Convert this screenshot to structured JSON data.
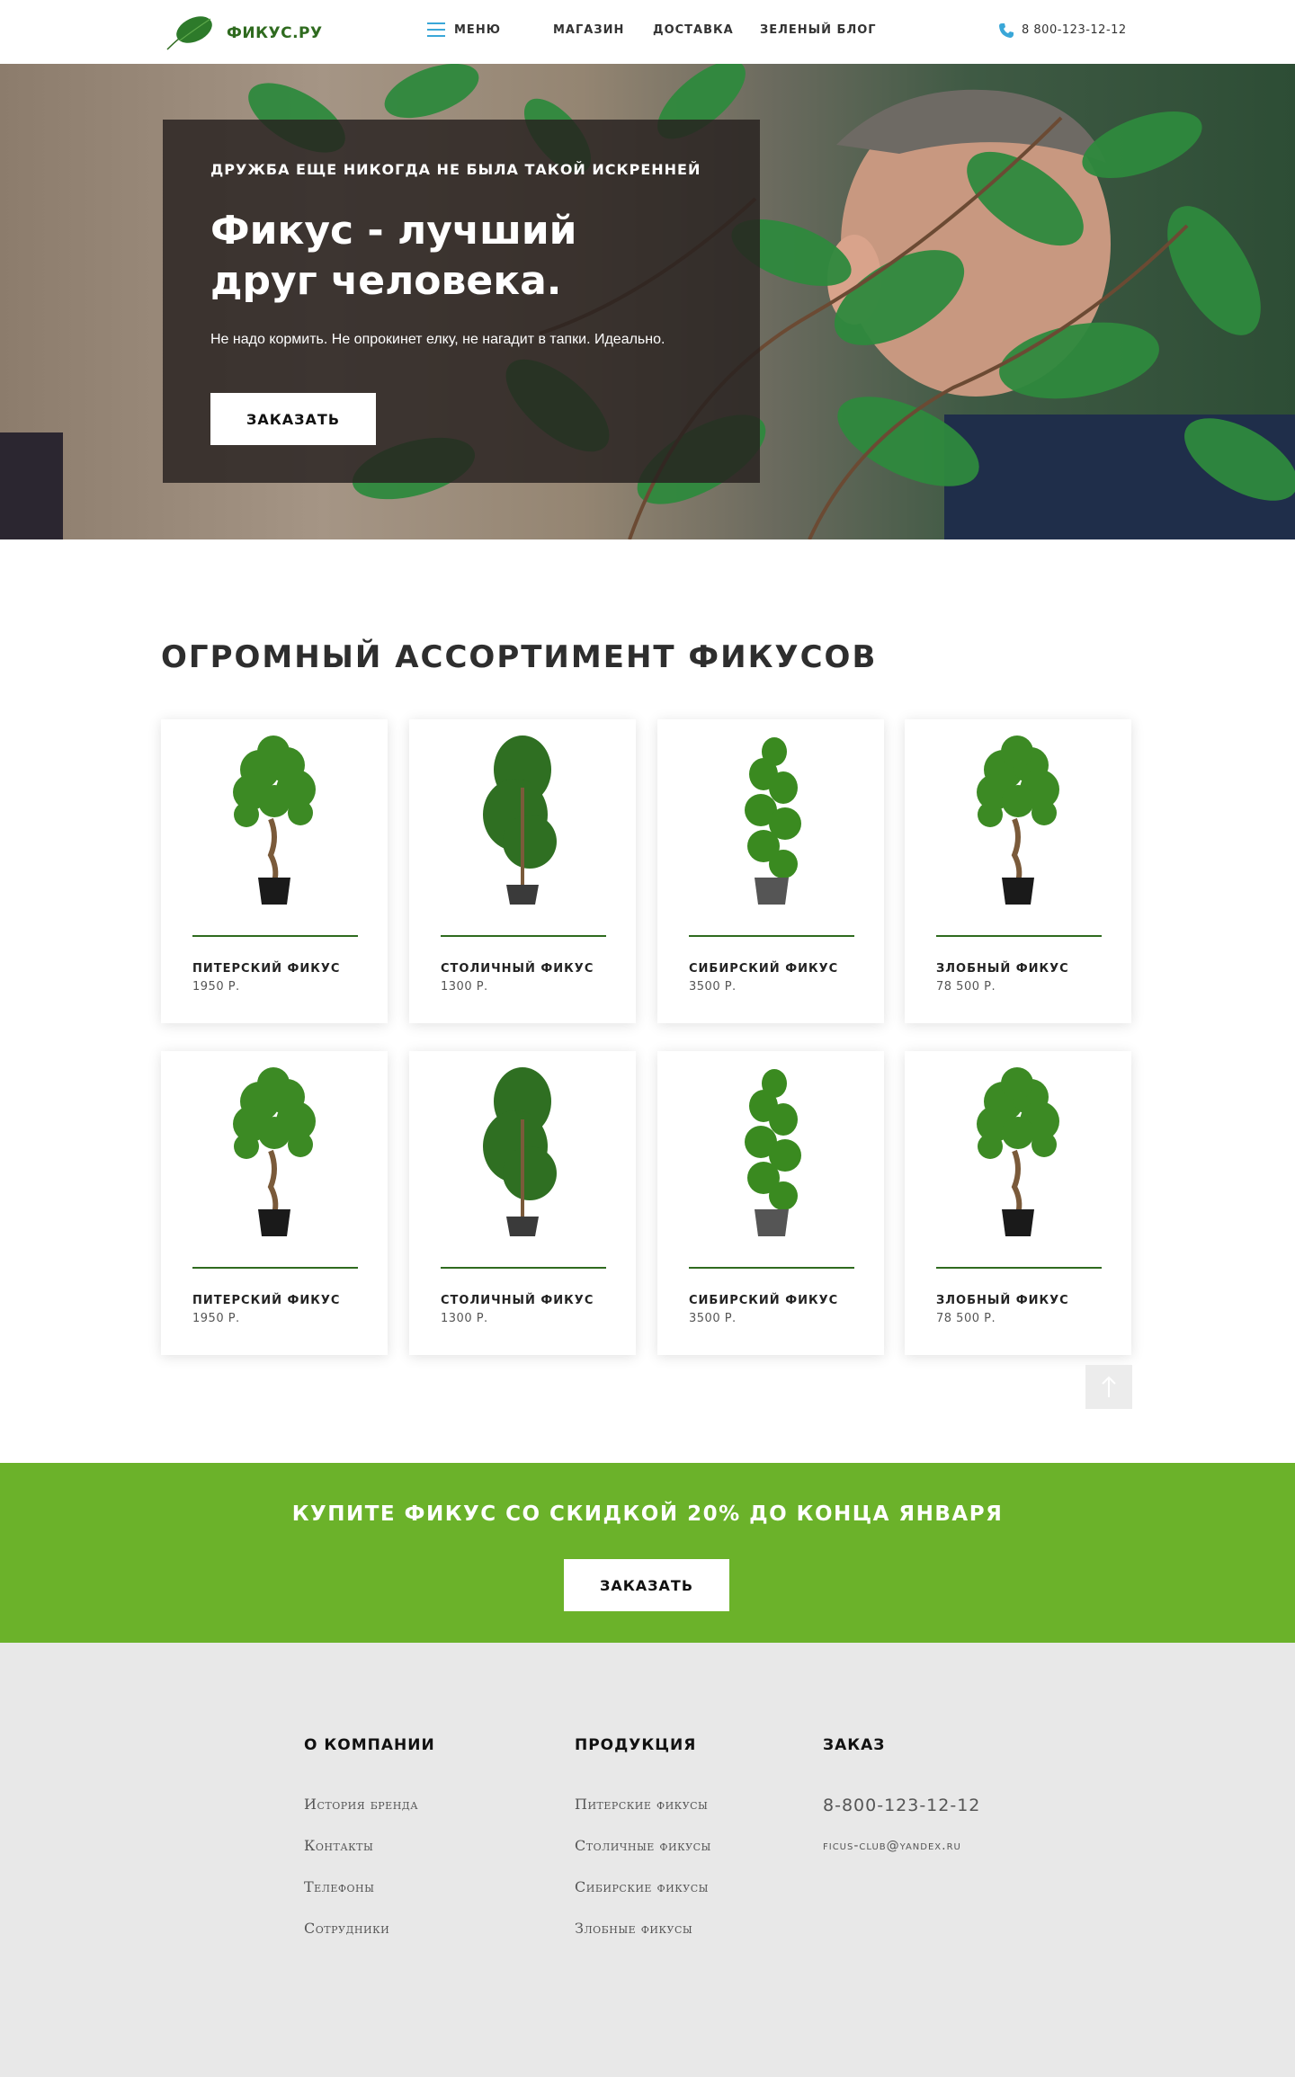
{
  "header": {
    "logo_text": "ФИКУС.РУ",
    "nav": {
      "menu": "МЕНЮ",
      "shop": "МАГАЗИН",
      "delivery": "ДОСТАВКА",
      "blog": "ЗЕЛЕНЫЙ БЛОГ"
    },
    "phone": "8 800-123-12-12"
  },
  "hero": {
    "kicker": "ДРУЖБА ЕЩЕ НИКОГДА НЕ БЫЛА ТАКОЙ ИСКРЕННЕЙ",
    "title": "Фикус - лучший друг человека.",
    "subtitle": "Не надо кормить. Не опрокинет елку, не нагадит в тапки. Идеально.",
    "button": "ЗАКАЗАТЬ"
  },
  "catalog": {
    "title": "ОГРОМНЫЙ АССОРТИМЕНТ ФИКУСОВ",
    "products": [
      {
        "name": "ПИТЕРСКИЙ ФИКУС",
        "price": "1950 Р."
      },
      {
        "name": "СТОЛИЧНЫЙ ФИКУС",
        "price": "1300 Р."
      },
      {
        "name": "СИБИРСКИЙ ФИКУС",
        "price": "3500 Р."
      },
      {
        "name": "ЗЛОБНЫЙ ФИКУС",
        "price": "78 500 Р."
      },
      {
        "name": "ПИТЕРСКИЙ ФИКУС",
        "price": "1950 Р."
      },
      {
        "name": "СТОЛИЧНЫЙ ФИКУС",
        "price": "1300 Р."
      },
      {
        "name": "СИБИРСКИЙ ФИКУС",
        "price": "3500 Р."
      },
      {
        "name": "ЗЛОБНЫЙ ФИКУС",
        "price": "78 500 Р."
      }
    ]
  },
  "promo": {
    "text": "КУПИТЕ ФИКУС СО СКИДКОЙ 20% ДО КОНЦА ЯНВАРЯ",
    "button": "ЗАКАЗАТЬ"
  },
  "footer": {
    "about": {
      "title": "О КОМПАНИИ",
      "links": [
        "История бренда",
        "Контакты",
        "Телефоны",
        "Сотрудники"
      ]
    },
    "products": {
      "title": "ПРОДУКЦИЯ",
      "links": [
        "Питерские фикусы",
        "Столичные фикусы",
        "Сибирские фикусы",
        "Злобные фикусы"
      ]
    },
    "order": {
      "title": "ЗАКАЗ",
      "phone": "8-800-123-12-12",
      "email": "ficus-club@yandex.ru"
    }
  },
  "colors": {
    "brand_green": "#2f6b1f",
    "promo_green": "#6bb22a",
    "footer_bg": "#e8e8e8",
    "accent_blue": "#3aa7d8"
  }
}
